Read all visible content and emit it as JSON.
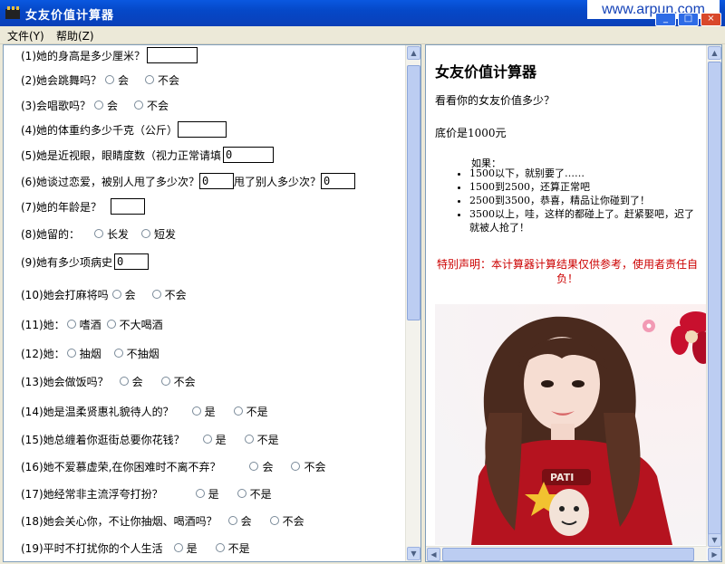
{
  "window": {
    "title": "女友价值计算器",
    "watermark": "www.arpun.com",
    "buttons": {
      "minimize": "_",
      "maximize": "□",
      "close": "×"
    }
  },
  "menu": [
    "文件(Y)",
    "帮助(Z)"
  ],
  "questions": {
    "q1": {
      "label": "(1)她的身高是多少厘米？",
      "value": ""
    },
    "q2": {
      "label": "(2)她会跳舞吗？",
      "options": [
        "会",
        "不会"
      ]
    },
    "q3": {
      "label": "(3)会唱歌吗？",
      "options": [
        "会",
        "不会"
      ]
    },
    "q4": {
      "label": "(4)她的体重约多少千克（公斤）",
      "value": ""
    },
    "q5": {
      "label": "(5)她是近视眼，眼睛度数（视力正常请填",
      "value": "0"
    },
    "q6": {
      "label": "(6)她谈过恋爱，被别人甩了多少次？",
      "value": "0",
      "label2": "甩了别人多少次？",
      "value2": "0"
    },
    "q7": {
      "label": "(7)她的年龄是？",
      "value": ""
    },
    "q8": {
      "label": "(8)她留的：",
      "options": [
        "长发",
        "短发"
      ]
    },
    "q9": {
      "label": "(9)她有多少项病史",
      "value": "0"
    },
    "q10": {
      "label": "(10)她会打麻将吗",
      "options": [
        "会",
        "不会"
      ]
    },
    "q11": {
      "label": "(11)她：",
      "options": [
        "嗜酒",
        "不大喝酒"
      ]
    },
    "q12": {
      "label": "(12)她：",
      "options": [
        "抽烟",
        "不抽烟"
      ]
    },
    "q13": {
      "label": "(13)她会做饭吗？",
      "options": [
        "会",
        "不会"
      ]
    },
    "q14": {
      "label": "(14)她是温柔贤惠礼貌待人的？",
      "options": [
        "是",
        "不是"
      ]
    },
    "q15": {
      "label": "(15)她总缠着你逛街总要你花钱？",
      "options": [
        "是",
        "不是"
      ]
    },
    "q16": {
      "label": "(16)她不爱慕虚荣,在你困难时不离不弃？",
      "options": [
        "会",
        "不会"
      ]
    },
    "q17": {
      "label": "(17)她经常非主流浮夸打扮？",
      "options": [
        "是",
        "不是"
      ]
    },
    "q18": {
      "label": "(18)她会关心你，不让你抽烟、喝酒吗？",
      "options": [
        "会",
        "不会"
      ]
    },
    "q19": {
      "label": "(19)平时不打扰你的个人生活",
      "options": [
        "是",
        "不是"
      ]
    }
  },
  "info": {
    "title": "女友价值计算器",
    "subtitle": "看看你的女友价值多少？",
    "base_price": "底价是1000元",
    "if_label": "如果：",
    "ranges": [
      "1500以下，就别要了……",
      "1500到2500，还算正常吧",
      "2500到3500，恭喜，精品让你碰到了！",
      "3500以上，哇，这样的都碰上了。赶紧娶吧，迟了就被人抢了！"
    ],
    "disclaimer": "特别声明：本计算器计算结果仅供参考，使用者责任自负！",
    "photo_shirt_text": "PATI"
  },
  "colors": {
    "titlebar": "#0548C8",
    "disclaimer": "#CC0000",
    "shirt": "#B5131F"
  }
}
